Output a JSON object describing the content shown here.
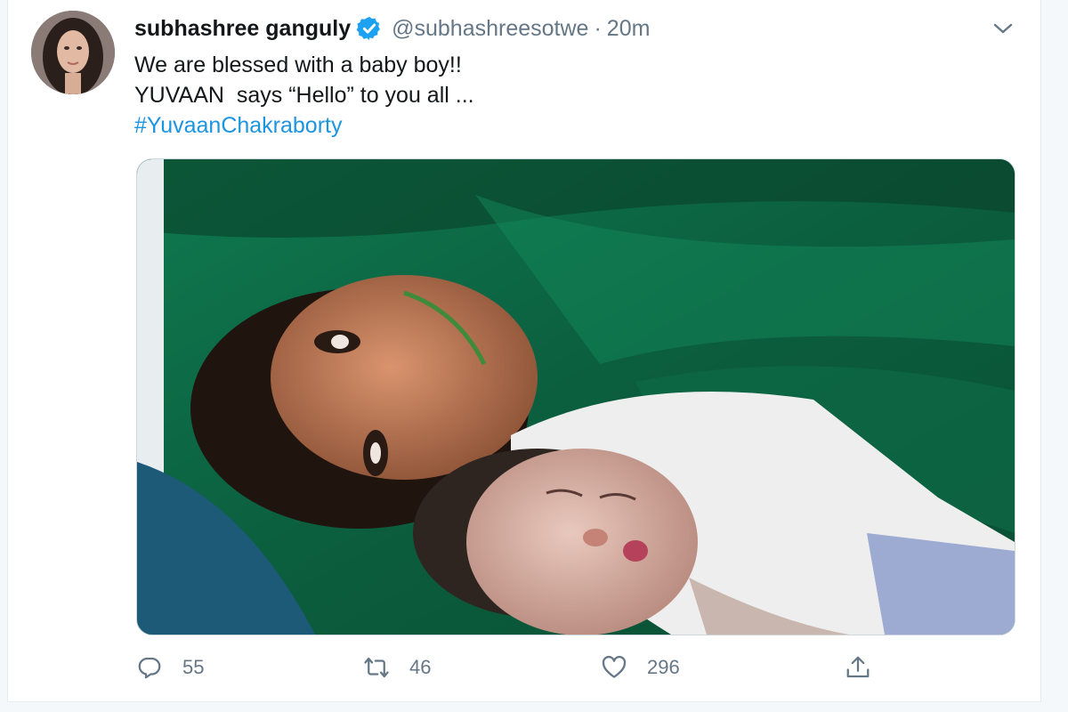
{
  "tweet": {
    "author_name": "subhashree ganguly",
    "handle": "@subhashreesotwe",
    "separator": "·",
    "time": "20m",
    "lines": [
      "We are blessed with a baby boy!!",
      "YUVAAN  says “Hello” to you all ..."
    ],
    "hashtag": "#YuvaanChakraborty"
  },
  "actions": {
    "replies": "55",
    "retweets": "46",
    "likes": "296"
  },
  "icons": {
    "verified": "verified-badge-icon",
    "more": "chevron-down-icon",
    "reply": "reply-icon",
    "retweet": "retweet-icon",
    "like": "heart-icon",
    "share": "share-icon"
  },
  "colors": {
    "link": "#1b95e0",
    "muted": "#657786",
    "verified": "#1da1f2"
  }
}
